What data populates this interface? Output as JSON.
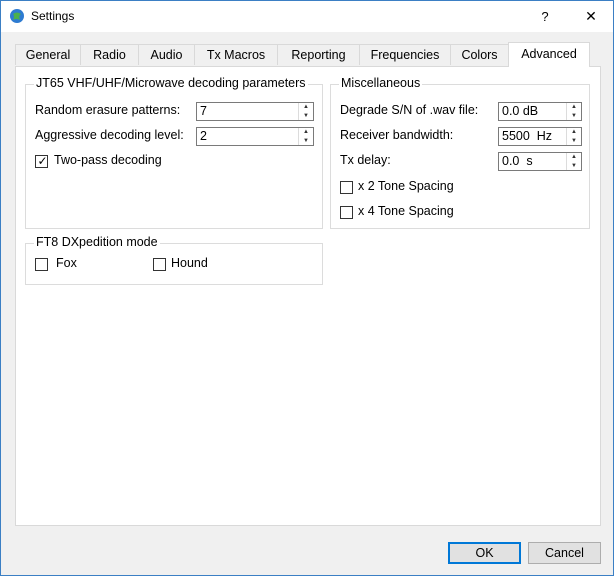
{
  "window": {
    "title": "Settings",
    "help": "?",
    "close": "✕"
  },
  "tabs": [
    {
      "label": "General"
    },
    {
      "label": "Radio"
    },
    {
      "label": "Audio"
    },
    {
      "label": "Tx Macros"
    },
    {
      "label": "Reporting"
    },
    {
      "label": "Frequencies"
    },
    {
      "label": "Colors"
    },
    {
      "label": "Advanced"
    }
  ],
  "active_tab": "Advanced",
  "jt65": {
    "title": "JT65 VHF/UHF/Microwave decoding parameters",
    "random_erasure_label": "Random erasure patterns:",
    "random_erasure_value": "7",
    "aggressive_label": "Aggressive decoding level:",
    "aggressive_value": "2",
    "two_pass_label": "Two-pass decoding",
    "two_pass_checked": true
  },
  "misc": {
    "title": "Miscellaneous",
    "degrade_label": "Degrade S/N of .wav file:",
    "degrade_value": "0.0 dB",
    "bandwidth_label": "Receiver bandwidth:",
    "bandwidth_value": "5500  Hz",
    "txdelay_label": "Tx delay:",
    "txdelay_value": "0.0  s",
    "x2_label": "x 2 Tone Spacing",
    "x2_checked": false,
    "x4_label": "x 4 Tone Spacing",
    "x4_checked": false
  },
  "ft8": {
    "title": "FT8 DXpedition mode",
    "fox_label": "Fox",
    "fox_checked": false,
    "hound_label": "Hound",
    "hound_checked": false
  },
  "buttons": {
    "ok": "OK",
    "cancel": "Cancel"
  }
}
